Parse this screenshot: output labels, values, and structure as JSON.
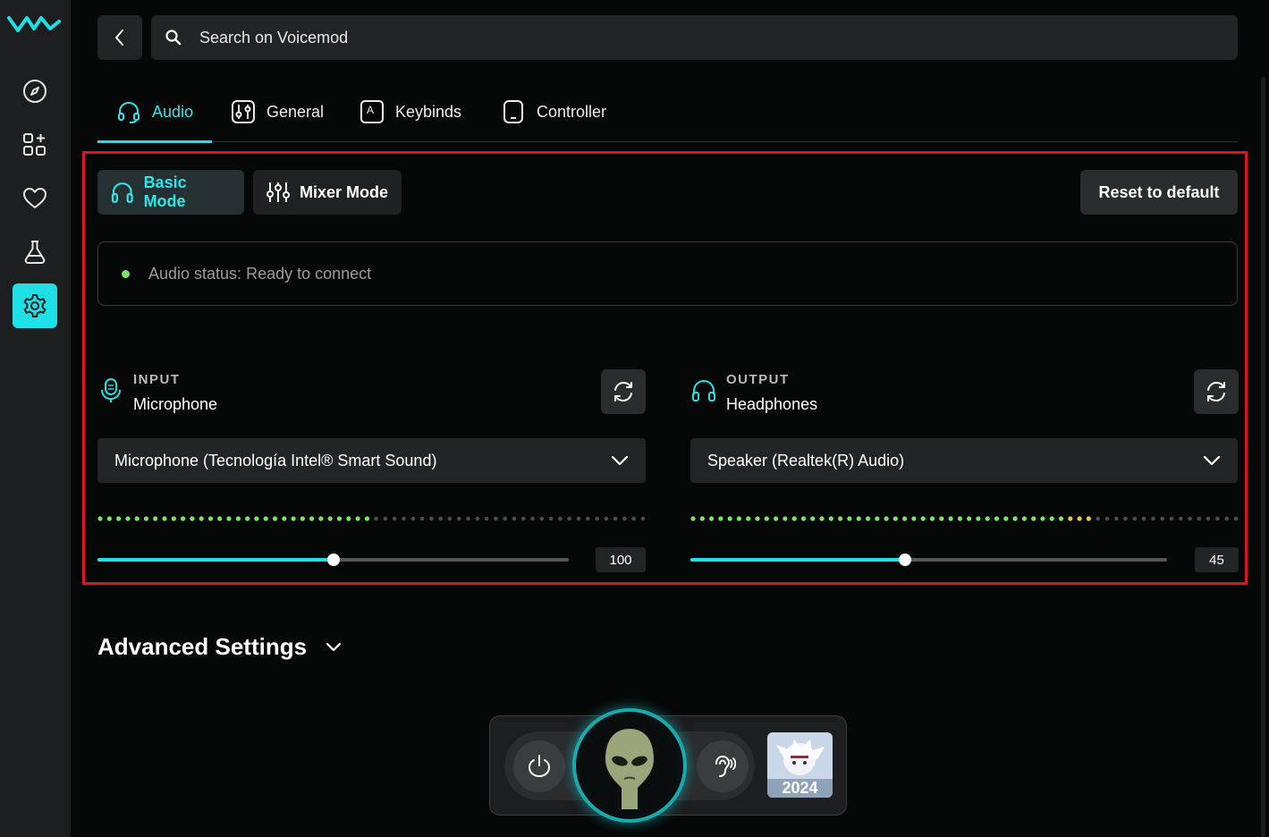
{
  "search": {
    "placeholder": "Search on Voicemod"
  },
  "sidebar": {
    "items": [
      {
        "name": "discover",
        "icon": "compass-icon"
      },
      {
        "name": "apps",
        "icon": "apps-grid-icon"
      },
      {
        "name": "favorites",
        "icon": "heart-icon"
      },
      {
        "name": "lab",
        "icon": "flask-icon"
      },
      {
        "name": "settings",
        "icon": "gear-icon",
        "active": true
      }
    ]
  },
  "tabs": [
    {
      "label": "Audio",
      "icon": "headset-icon",
      "active": true
    },
    {
      "label": "General",
      "icon": "sliders-icon"
    },
    {
      "label": "Keybinds",
      "icon": "keyboard-key-icon"
    },
    {
      "label": "Controller",
      "icon": "controller-icon"
    }
  ],
  "modes": {
    "basic_label": "Basic Mode",
    "mixer_label": "Mixer Mode",
    "active": "Basic Mode"
  },
  "reset_label": "Reset to default",
  "audio_status": {
    "text": "Audio status: Ready to connect",
    "color": "#7be36a"
  },
  "input": {
    "caption": "INPUT",
    "type": "Microphone",
    "device": "Microphone (Tecnología Intel® Smart Sound)",
    "level": 0.5,
    "volume": "100",
    "volume_fraction": 0.5
  },
  "output": {
    "caption": "OUTPUT",
    "type": "Headphones",
    "device": "Speaker (Realtek(R) Audio)",
    "level": 0.73,
    "volume": "45",
    "volume_fraction": 0.45
  },
  "advanced": {
    "label": "Advanced Settings"
  },
  "dock": {
    "thumb_text": "2024"
  },
  "colors": {
    "accent": "#1ee0e6",
    "meter_green": "#7be36a",
    "meter_yellow": "#e5c84a",
    "meter_off": "#4a4d50",
    "highlight": "#e0141f"
  }
}
